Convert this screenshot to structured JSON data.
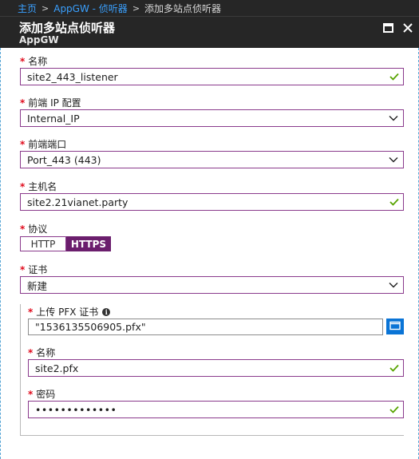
{
  "breadcrumb": {
    "home": "主页",
    "parent": "AppGW - 侦听器",
    "current": "添加多站点侦听器"
  },
  "header": {
    "title": "添加多站点侦听器",
    "subtitle": "AppGW",
    "icons": [
      "maximize-icon",
      "close-icon"
    ]
  },
  "form": {
    "name": {
      "label": "名称",
      "value": "site2_443_listener"
    },
    "frontend_ip": {
      "label": "前端 IP 配置",
      "value": "Internal_IP"
    },
    "frontend_port": {
      "label": "前端端口",
      "value": "Port_443 (443)"
    },
    "host_name": {
      "label": "主机名",
      "value": "site2.21vianet.party"
    },
    "protocol": {
      "label": "协议",
      "options": [
        "HTTP",
        "HTTPS"
      ],
      "selected": "HTTPS"
    },
    "certificate": {
      "label": "证书",
      "value": "新建"
    },
    "upload_pfx": {
      "label": "上传 PFX 证书",
      "value": "\"1536135506905.pfx\""
    },
    "cert_name": {
      "label": "名称",
      "value": "site2.pfx"
    },
    "password": {
      "label": "密码",
      "value": "•••••••••••••"
    }
  },
  "colors": {
    "accent": "#6b1e6d",
    "required": "#e00b1c",
    "valid": "#57a300",
    "link": "#3aa0ff",
    "browse": "#0a74d6"
  }
}
